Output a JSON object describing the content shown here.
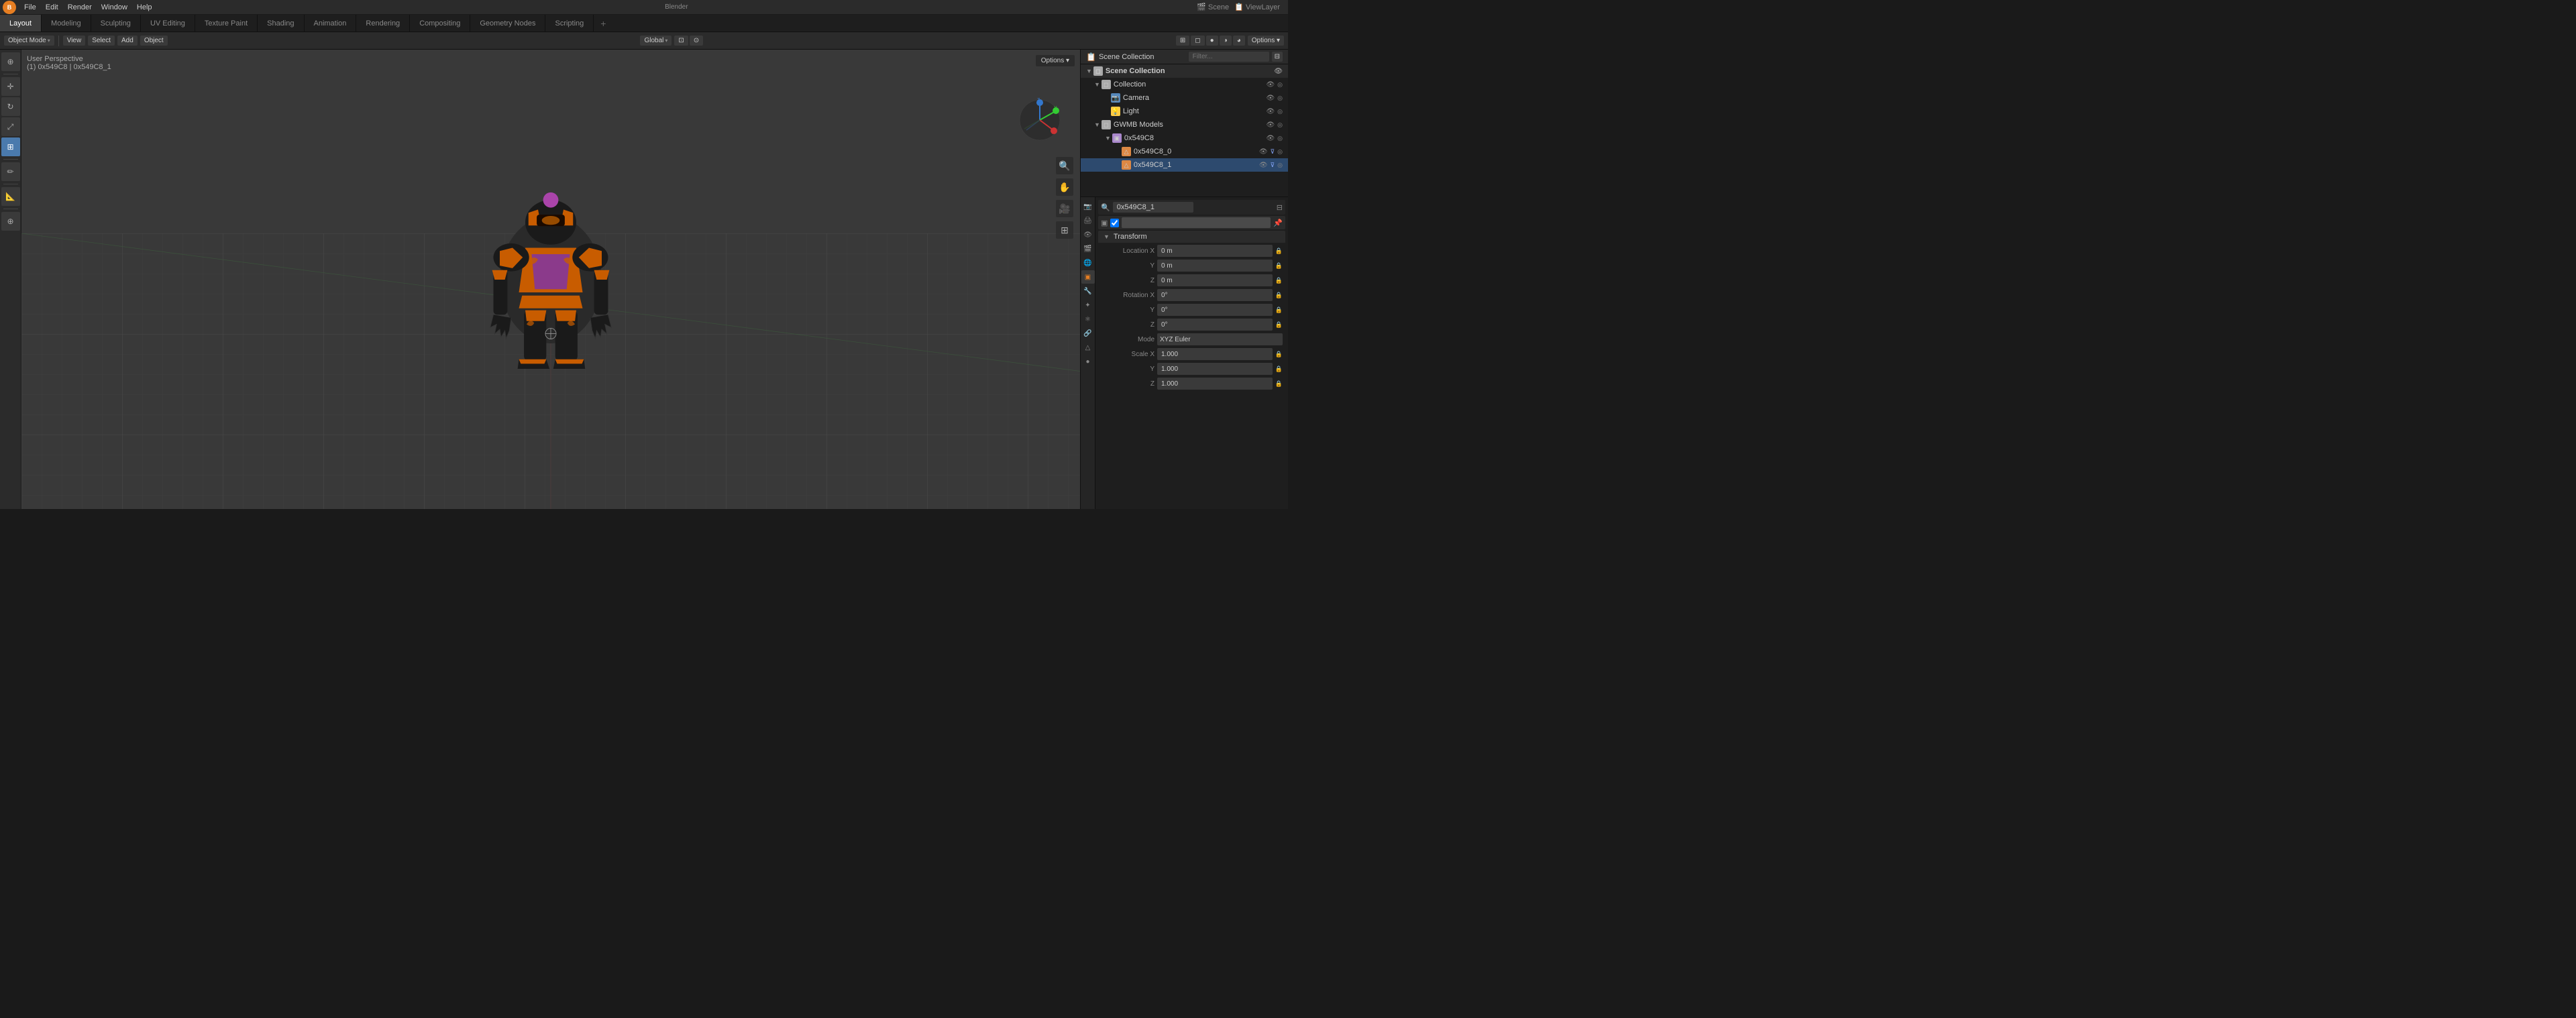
{
  "app": {
    "title": "Blender",
    "logo": "B"
  },
  "top_menu": {
    "items": [
      {
        "id": "file",
        "label": "File"
      },
      {
        "id": "edit",
        "label": "Edit"
      },
      {
        "id": "render",
        "label": "Render"
      },
      {
        "id": "window",
        "label": "Window"
      },
      {
        "id": "help",
        "label": "Help"
      }
    ]
  },
  "workspace_tabs": [
    {
      "id": "layout",
      "label": "Layout",
      "active": true
    },
    {
      "id": "modeling",
      "label": "Modeling"
    },
    {
      "id": "sculpting",
      "label": "Sculpting"
    },
    {
      "id": "uv_editing",
      "label": "UV Editing"
    },
    {
      "id": "texture_paint",
      "label": "Texture Paint"
    },
    {
      "id": "shading",
      "label": "Shading"
    },
    {
      "id": "animation",
      "label": "Animation"
    },
    {
      "id": "rendering",
      "label": "Rendering"
    },
    {
      "id": "compositing",
      "label": "Compositing"
    },
    {
      "id": "geometry_nodes",
      "label": "Geometry Nodes"
    },
    {
      "id": "scripting",
      "label": "Scripting"
    }
  ],
  "add_tab": "+",
  "header_toolbar": {
    "mode": "Object Mode",
    "view_label": "View",
    "select_label": "Select",
    "add_label": "Add",
    "object_label": "Object",
    "global_label": "Global",
    "options_label": "Options ▾"
  },
  "viewport": {
    "info_line1": "User Perspective",
    "info_line2": "(1) 0x549C8 | 0x549C8_1"
  },
  "outliner": {
    "header": "Scene Collection",
    "search_placeholder": "Filter...",
    "items": [
      {
        "id": "scene_collection",
        "label": "Scene Collection",
        "level": 0,
        "icon": "collection",
        "expanded": true,
        "visible": true
      },
      {
        "id": "collection",
        "label": "Collection",
        "level": 1,
        "icon": "collection",
        "expanded": true,
        "visible": true
      },
      {
        "id": "camera",
        "label": "Camera",
        "level": 2,
        "icon": "camera",
        "expanded": false,
        "visible": true
      },
      {
        "id": "light",
        "label": "Light",
        "level": 2,
        "icon": "light",
        "expanded": false,
        "visible": true
      },
      {
        "id": "gwmb_models",
        "label": "GWMB Models",
        "level": 1,
        "icon": "collection",
        "expanded": true,
        "visible": true
      },
      {
        "id": "0x549C8",
        "label": "0x549C8",
        "level": 2,
        "icon": "object",
        "expanded": true,
        "visible": true
      },
      {
        "id": "0x549C8_0",
        "label": "0x549C8_0",
        "level": 3,
        "icon": "mesh",
        "expanded": false,
        "visible": true
      },
      {
        "id": "0x549C8_1",
        "label": "0x549C8_1",
        "level": 3,
        "icon": "mesh",
        "expanded": false,
        "visible": true,
        "selected": true
      }
    ]
  },
  "properties": {
    "panel_header": "0x549C8_1",
    "object_name": "0x549C8_1",
    "transform_header": "Transform",
    "location_label": "Location",
    "location_x_label": "X",
    "location_x": "0 m",
    "location_y_label": "Y",
    "location_y": "0 m",
    "location_z_label": "Z",
    "location_z": "0 m",
    "rotation_label": "Rotation X",
    "rotation_x": "0°",
    "rotation_y_label": "Y",
    "rotation_y": "0°",
    "rotation_z_label": "Z",
    "rotation_z": "0°",
    "mode_label": "Mode",
    "mode_value": "XYZ Euler",
    "scale_label": "Scale X",
    "scale_x": "1.000",
    "scale_y_label": "Y",
    "scale_y": "1.000",
    "scale_z_label": "Z",
    "scale_z": "1.000",
    "tabs": [
      {
        "id": "render",
        "icon": "📷",
        "active": false
      },
      {
        "id": "output",
        "icon": "🖨",
        "active": false
      },
      {
        "id": "view",
        "icon": "👁",
        "active": false
      },
      {
        "id": "object",
        "icon": "▣",
        "active": true
      },
      {
        "id": "modifier",
        "icon": "🔧",
        "active": false
      },
      {
        "id": "particles",
        "icon": "✦",
        "active": false
      },
      {
        "id": "physics",
        "icon": "⚛",
        "active": false
      },
      {
        "id": "constraints",
        "icon": "🔗",
        "active": false
      },
      {
        "id": "data",
        "icon": "△",
        "active": false
      },
      {
        "id": "material",
        "icon": "●",
        "active": false
      }
    ]
  },
  "left_tools": [
    {
      "id": "cursor",
      "icon": "⊕",
      "active": false
    },
    {
      "id": "move",
      "icon": "✛",
      "active": false
    },
    {
      "id": "rotate",
      "icon": "↻",
      "active": false
    },
    {
      "id": "scale",
      "icon": "⤢",
      "active": false
    },
    {
      "id": "transform",
      "icon": "⊞",
      "active": true
    },
    {
      "id": "annotate",
      "icon": "✏",
      "active": false
    },
    {
      "id": "measure",
      "icon": "📐",
      "active": false
    },
    {
      "id": "add",
      "icon": "⊕",
      "active": false
    }
  ],
  "nav_buttons": [
    {
      "id": "zoom",
      "icon": "🔍"
    },
    {
      "id": "move",
      "icon": "✋"
    },
    {
      "id": "camera",
      "icon": "🎥"
    },
    {
      "id": "grid",
      "icon": "⊞"
    }
  ],
  "gizmo": {
    "x_color": "#cc3333",
    "y_color": "#33cc33",
    "z_color": "#3377cc"
  },
  "colors": {
    "bg_dark": "#1e1e1e",
    "bg_mid": "#2b2b2b",
    "bg_light": "#3a3a3a",
    "accent": "#4a7aad",
    "accent_orange": "#e67e22",
    "selected_blue": "#2d4a6e",
    "text_bright": "#ffffff",
    "text_mid": "#cccccc",
    "text_dim": "#888888"
  }
}
